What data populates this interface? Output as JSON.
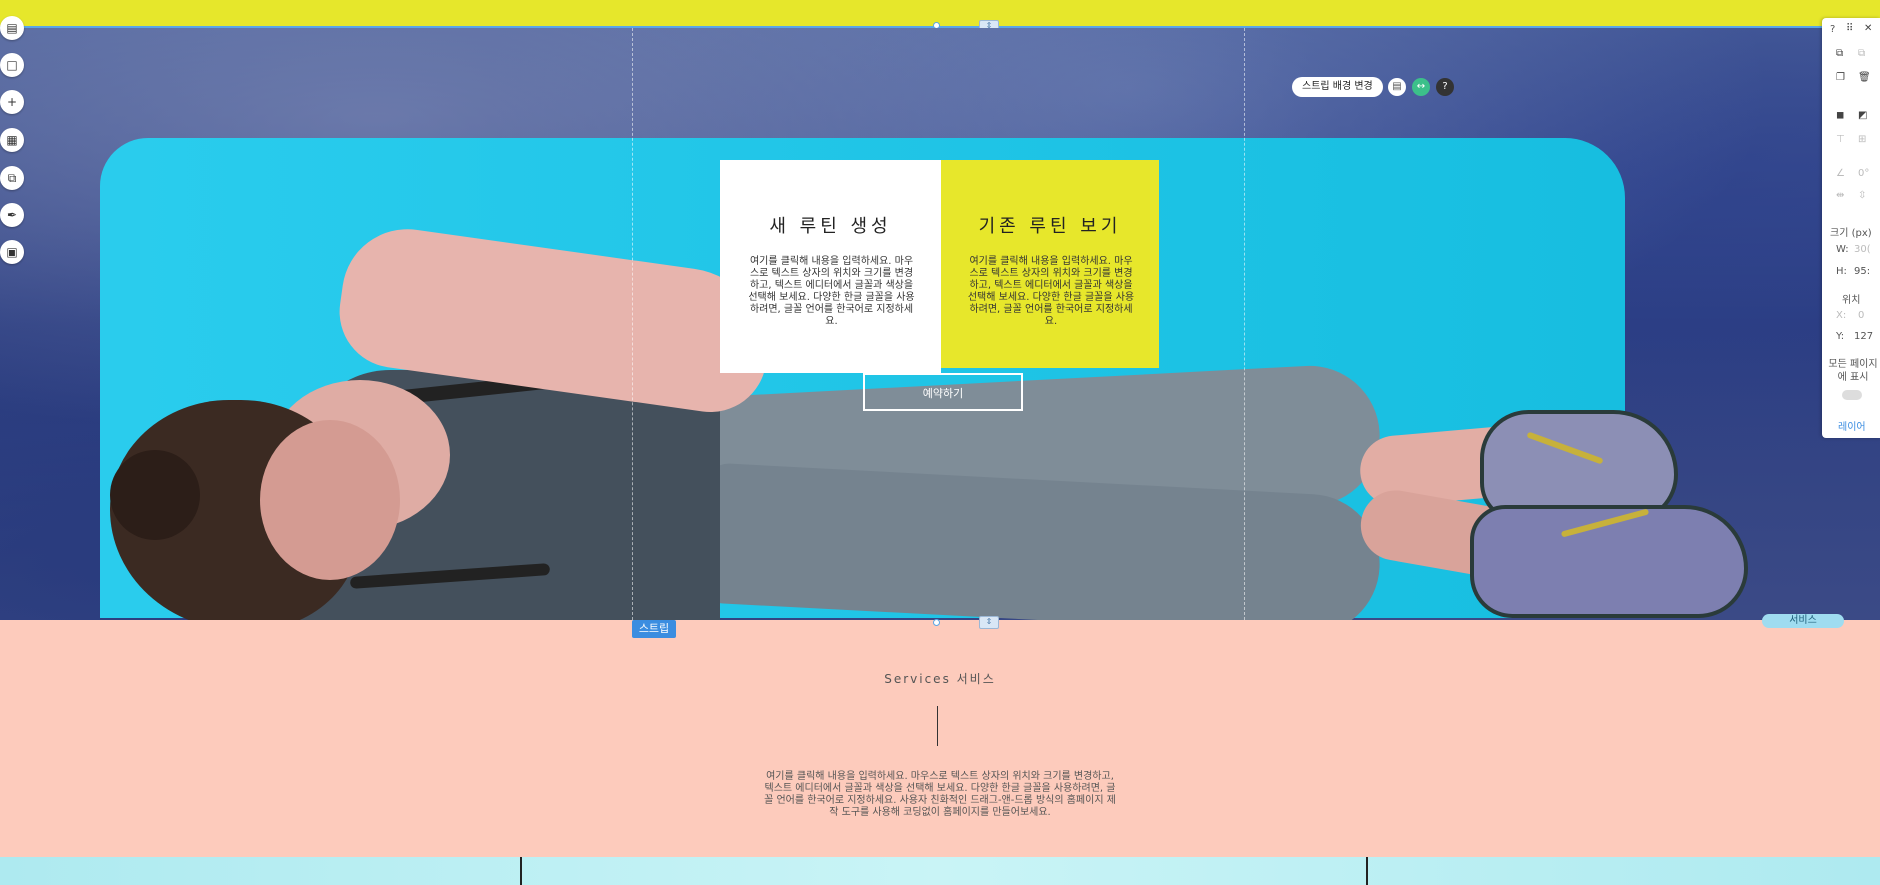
{
  "toolbar_left": {
    "icons": [
      "pages-icon",
      "background-icon",
      "add-icon",
      "apps-icon",
      "media-icon",
      "pen-icon",
      "calendar-icon"
    ]
  },
  "hero": {
    "strip_bg_button": "스트립 배경 변경",
    "cards": [
      {
        "title": "새 루틴 생성",
        "body": "여기를 클릭해 내용을 입력하세요. 마우스로 텍스트 상자의 위치와 크기를 변경하고, 텍스트 에디터에서 글꼴과 색상을 선택해 보세요. 다양한 한글 글꼴을 사용하려면, 글꼴 언어를 한국어로 지정하세요."
      },
      {
        "title": "기존 루틴 보기",
        "body": "여기를 클릭해 내용을 입력하세요. 마우스로 텍스트 상자의 위치와 크기를 변경하고, 텍스트 에디터에서 글꼴과 색상을 선택해 보세요. 다양한 한글 글꼴을 사용하려면, 글꼴 언어를 한국어로 지정하세요."
      }
    ],
    "cta": "예약하기",
    "strip_badge": "스트립",
    "section_tag": "서비스"
  },
  "services": {
    "title": "Services 서비스",
    "body": "여기를 클릭해 내용을 입력하세요. 마우스로 텍스트 상자의 위치와 크기를 변경하고, 텍스트 에디터에서 글꼴과 색상을 선택해 보세요. 다양한 한글 글꼴을 사용하려면, 글꼴 언어를 한국어로 지정하세요. 사용자 친화적인 드래그-앤-드롭 방식의 홈페이지 제작 도구를 사용해 코딩없이 홈페이지를 만들어보세요."
  },
  "right_panel": {
    "help": "?",
    "size_label": "크기 (px)",
    "w_label": "W:",
    "w_value": "30(",
    "h_label": "H:",
    "h_value": "95:",
    "position_label": "위치",
    "x_label": "X:",
    "x_value": "0",
    "y_label": "Y:",
    "y_value": "127",
    "angle_value": "0°",
    "show_all_pages": "모든 페이지에 표시",
    "layers": "레이어"
  },
  "colors": {
    "top_bar": "#e6e72b",
    "card_right": "#e7e72b",
    "services_bg": "#fdcbbc",
    "selection_blue": "#3b8de0"
  }
}
